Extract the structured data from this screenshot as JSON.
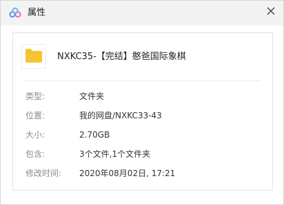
{
  "window": {
    "title": "属性",
    "app_icon": "cloud-drive-logo-icon",
    "close_icon": "close-icon"
  },
  "file": {
    "icon": "folder-icon",
    "name": "NXKC35-【完结】憨爸国际象棋"
  },
  "properties": [
    {
      "label": "类型:",
      "value": "文件夹"
    },
    {
      "label": "位置:",
      "value": "我的网盘/NXKC33-43"
    },
    {
      "label": "大小:",
      "value": "2.70GB"
    },
    {
      "label": "包含:",
      "value": "3个文件,1个文件夹"
    },
    {
      "label": "修改时间:",
      "value": "2020年08月02日, 17:21"
    }
  ],
  "colors": {
    "titlebar_bg": "#f3f3f3",
    "folder_yellow": "#f7c531",
    "logo_blue": "#3a8ef6",
    "logo_pink": "#ef5fa7"
  }
}
